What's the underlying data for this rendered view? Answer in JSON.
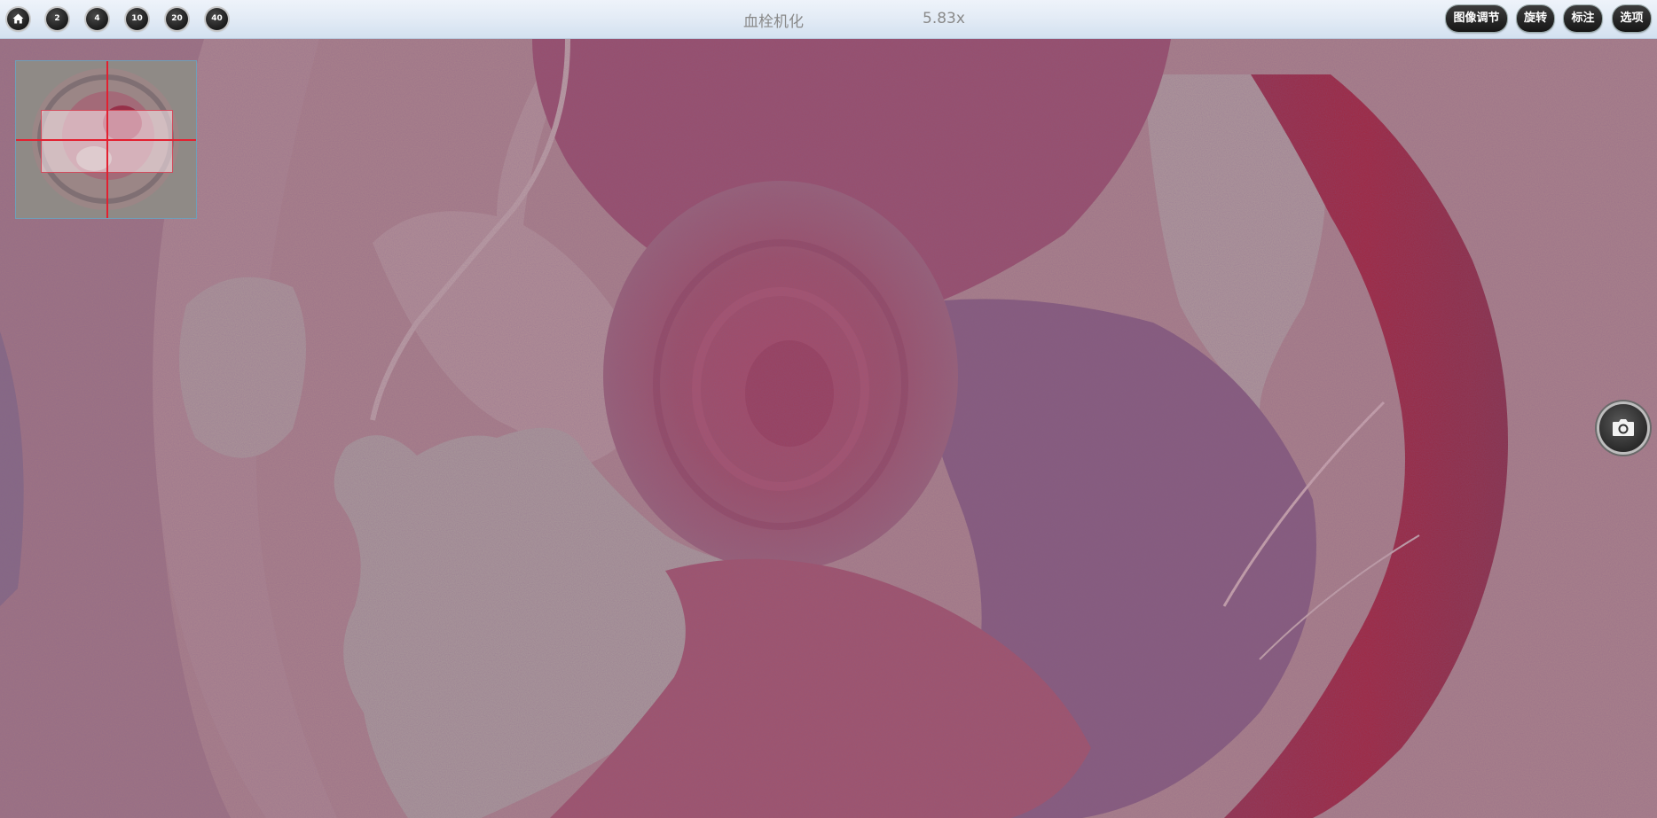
{
  "toolbar": {
    "magnifications": [
      "2",
      "4",
      "10",
      "20",
      "40"
    ],
    "title": "血栓机化",
    "zoom": "5.83x",
    "buttons": {
      "image_adjust": "图像调节",
      "rotate": "旋转",
      "annotate": "标注",
      "options": "选项"
    }
  },
  "icons": {
    "home": "home-icon",
    "snapshot": "camera-icon"
  },
  "colors": {
    "toolbar_bg": "#e4ecf6",
    "button_bg": "#1c1c1c",
    "tissue_pink": "#b5878f",
    "thrombus_red": "#a3283f",
    "navigator_marker": "#e32030"
  }
}
